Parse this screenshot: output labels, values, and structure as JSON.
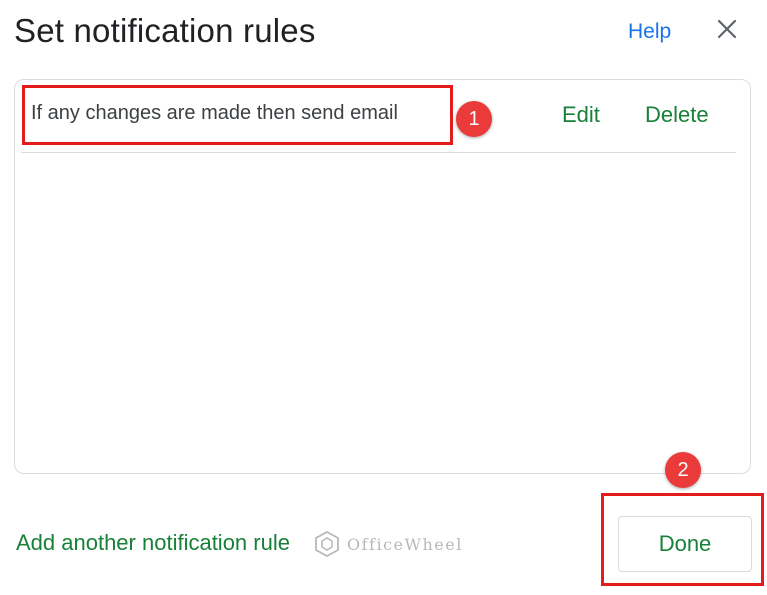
{
  "dialog": {
    "title": "Set notification rules",
    "help_label": "Help",
    "close_icon": "close-icon"
  },
  "rules": [
    {
      "text": "If any changes are made then send email",
      "edit_label": "Edit",
      "delete_label": "Delete"
    }
  ],
  "footer": {
    "add_rule_label": "Add another notification rule",
    "done_label": "Done"
  },
  "annotations": {
    "callout_1": "1",
    "callout_2": "2",
    "highlight_color": "#e21b1b",
    "callout_color": "#ea3a3a"
  },
  "watermark": {
    "logo": "officewheel-logo",
    "text": "OfficeWheel"
  },
  "colors": {
    "link_blue": "#1a73e8",
    "action_green": "#188038",
    "title_text": "#202124"
  }
}
